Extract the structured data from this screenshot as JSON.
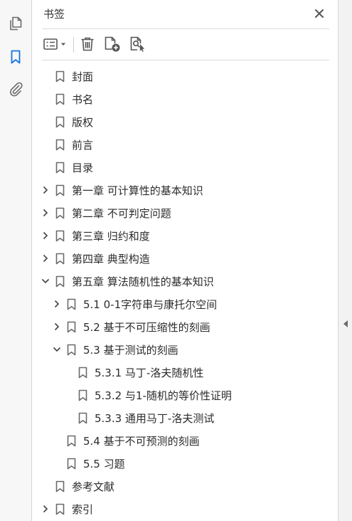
{
  "panel": {
    "title": "书签"
  },
  "colors": {
    "accent": "#1473e6",
    "icon_gray": "#6b6b6b",
    "text": "#2c2c2c"
  },
  "left_rail": {
    "icons": [
      "pages-icon",
      "bookmark-icon",
      "attachment-icon"
    ],
    "active": "bookmark-icon"
  },
  "toolbar": {
    "buttons": [
      "options-menu-icon",
      "delete-icon",
      "new-bookmark-icon",
      "find-bookmark-icon"
    ]
  },
  "bookmarks": [
    {
      "label": "封面",
      "level": 0,
      "expander": "none"
    },
    {
      "label": "书名",
      "level": 0,
      "expander": "none"
    },
    {
      "label": "版权",
      "level": 0,
      "expander": "none"
    },
    {
      "label": "前言",
      "level": 0,
      "expander": "none"
    },
    {
      "label": "目录",
      "level": 0,
      "expander": "none"
    },
    {
      "label": "第一章  可计算性的基本知识",
      "level": 0,
      "expander": "collapsed"
    },
    {
      "label": "第二章  不可判定问题",
      "level": 0,
      "expander": "collapsed"
    },
    {
      "label": "第三章  归约和度",
      "level": 0,
      "expander": "collapsed"
    },
    {
      "label": "第四章  典型构造",
      "level": 0,
      "expander": "collapsed"
    },
    {
      "label": "第五章  算法随机性的基本知识",
      "level": 0,
      "expander": "expanded"
    },
    {
      "label": "5.1  0-1字符串与康托尔空间",
      "level": 1,
      "expander": "collapsed"
    },
    {
      "label": "5.2  基于不可压缩性的刻画",
      "level": 1,
      "expander": "collapsed"
    },
    {
      "label": "5.3  基于测试的刻画",
      "level": 1,
      "expander": "expanded"
    },
    {
      "label": "5.3.1  马丁-洛夫随机性",
      "level": 2,
      "expander": "none"
    },
    {
      "label": "5.3.2  与1-随机的等价性证明",
      "level": 2,
      "expander": "none"
    },
    {
      "label": "5.3.3  通用马丁-洛夫测试",
      "level": 2,
      "expander": "none"
    },
    {
      "label": "5.4  基于不可预测的刻画",
      "level": 1,
      "expander": "none"
    },
    {
      "label": "5.5  习题",
      "level": 1,
      "expander": "none"
    },
    {
      "label": "参考文献",
      "level": 0,
      "expander": "none"
    },
    {
      "label": "索引",
      "level": 0,
      "expander": "collapsed"
    }
  ]
}
